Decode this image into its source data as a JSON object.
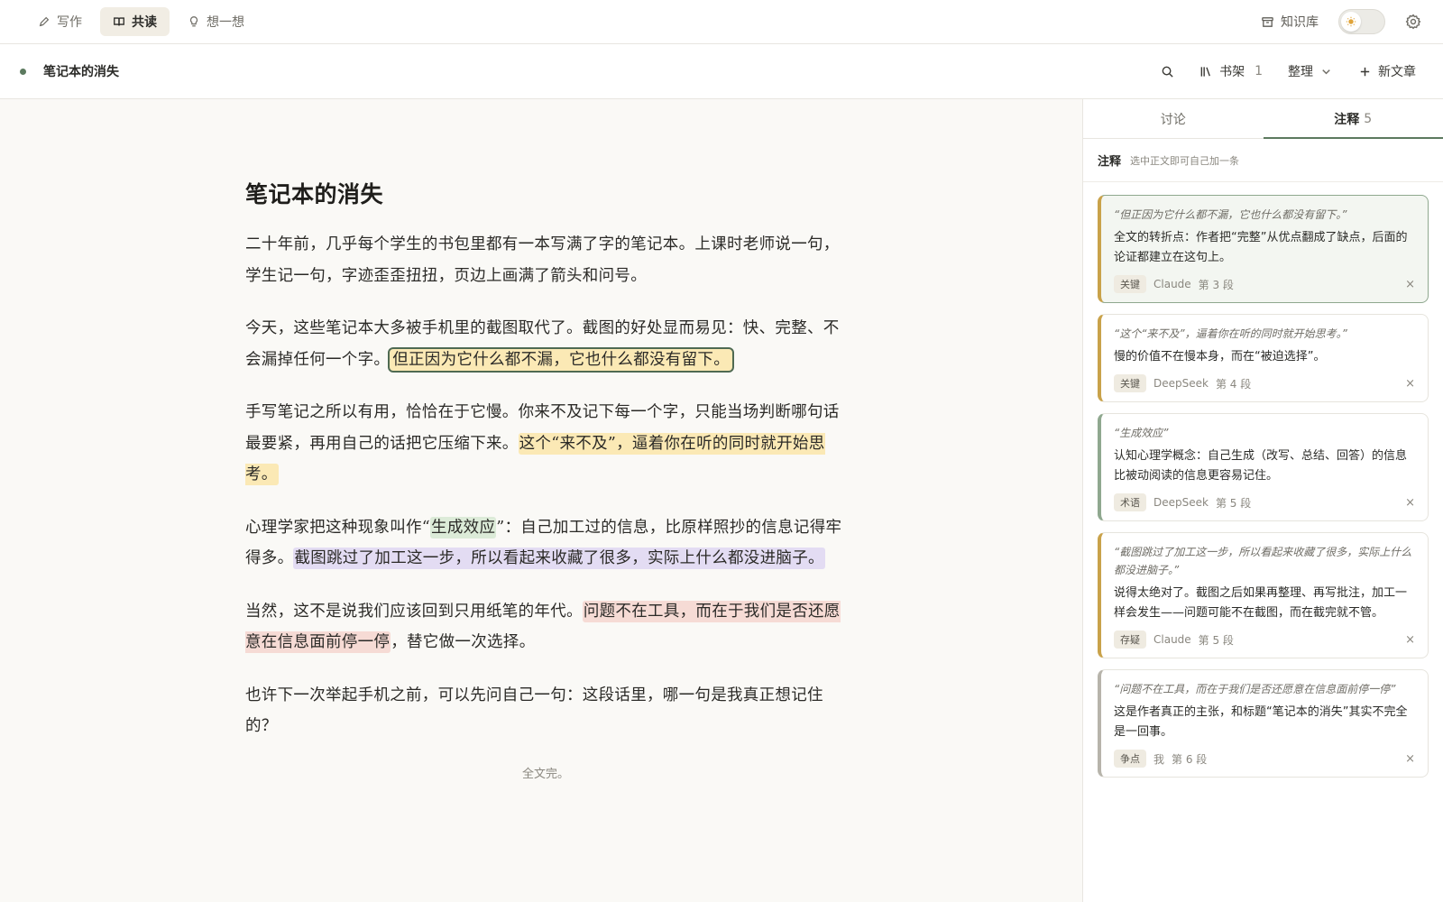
{
  "topbar": {
    "tabs": [
      {
        "label": "写作",
        "icon": "pen-icon"
      },
      {
        "label": "共读",
        "icon": "book-open-icon"
      },
      {
        "label": "想一想",
        "icon": "lightbulb-icon"
      }
    ],
    "active_tab": "共读",
    "knowledge_base_label": "知识库"
  },
  "docbar": {
    "title": "笔记本的消失",
    "bookshelf_label": "书架",
    "bookshelf_count": "1",
    "organize_label": "整理",
    "new_article_label": "新文章"
  },
  "article": {
    "title": "笔记本的消失",
    "p1": "二十年前，几乎每个学生的书包里都有一本写满了字的笔记本。上课时老师说一句，学生记一句，字迹歪歪扭扭，页边上画满了箭头和问号。",
    "p2_a": "今天，这些笔记本大多被手机里的截图取代了。截图的好处显而易见：快、完整、不会漏掉任何一个字。",
    "p2_hl": "但正因为它什么都不漏，它也什么都没有留下。",
    "p3_a": "手写笔记之所以有用，恰恰在于它慢。你来不及记下每一个字，只能当场判断哪句话最要紧，再用自己的话把它压缩下来。",
    "p3_hl": "这个“来不及”，逼着你在听的同时就开始思考。",
    "p4_a": "心理学家把这种现象叫作“",
    "p4_term": "生成效应",
    "p4_b": "”：自己加工过的信息，比原样照抄的信息记得牢得多。",
    "p4_hl": "截图跳过了加工这一步，所以看起来收藏了很多，实际上什么都没进脑子。",
    "p5_a": "当然，这不是说我们应该回到只用纸笔的年代。",
    "p5_hl": "问题不在工具，而在于我们是否还愿意在信息面前停一停",
    "p5_b": "，替它做一次选择。",
    "p6": "也许下一次举起手机之前，可以先问自己一句：这段话里，哪一句是我真正想记住的？",
    "end": "全文完。"
  },
  "panel": {
    "tabs": [
      {
        "label": "讨论",
        "count": ""
      },
      {
        "label": "注释",
        "count": "5"
      }
    ],
    "sub_title": "注释",
    "sub_hint": "选中正文即可自己加一条",
    "notes": [
      {
        "quote": "“但正因为它什么都不漏，它也什么都没有留下。”",
        "body": "全文的转折点：作者把“完整”从优点翻成了缺点，后面的论证都建立在这句上。",
        "tag": "关键",
        "author": "Claude",
        "para": "第 3 段"
      },
      {
        "quote": "“这个“来不及”，逼着你在听的同时就开始思考。”",
        "body": "慢的价值不在慢本身，而在“被迫选择”。",
        "tag": "关键",
        "author": "DeepSeek",
        "para": "第 4 段"
      },
      {
        "quote": "“生成效应”",
        "body": "认知心理学概念：自己生成（改写、总结、回答）的信息比被动阅读的信息更容易记住。",
        "tag": "术语",
        "author": "DeepSeek",
        "para": "第 5 段"
      },
      {
        "quote": "“截图跳过了加工这一步，所以看起来收藏了很多，实际上什么都没进脑子。”",
        "body": "说得太绝对了。截图之后如果再整理、再写批注，加工一样会发生——问题可能不在截图，而在截完就不管。",
        "tag": "存疑",
        "author": "Claude",
        "para": "第 5 段"
      },
      {
        "quote": "“问题不在工具，而在于我们是否还愿意在信息面前停一停”",
        "body": "这是作者真正的主张，和标题“笔记本的消失”其实不完全是一回事。",
        "tag": "争点",
        "author": "我",
        "para": "第 6 段"
      }
    ],
    "close_glyph": "×"
  },
  "colors": {
    "accent": "#5c7a5f",
    "highlight_key": "#fbe9b5",
    "highlight_term": "#dcebd8",
    "highlight_doubt": "#e3dcf3",
    "highlight_dispute": "#f6dbd5"
  }
}
